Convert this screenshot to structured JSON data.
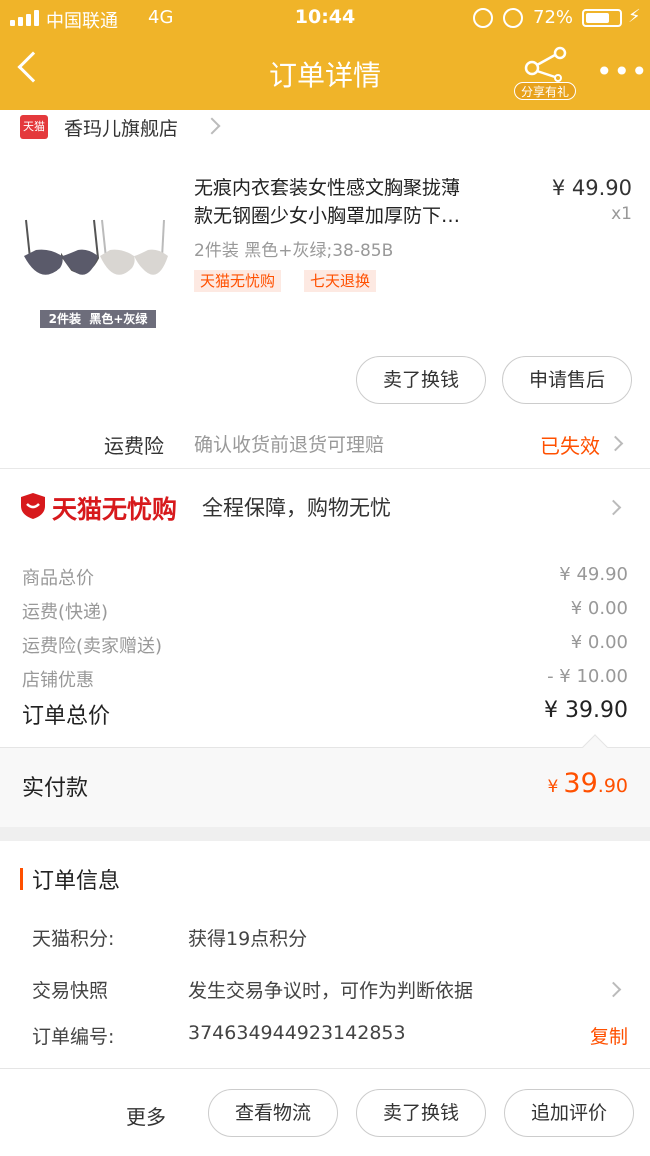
{
  "status_bar": {
    "carrier": "中国联通",
    "network": "4G",
    "time": "10:44",
    "battery": "72%",
    "battery_level": 0.72
  },
  "nav": {
    "title": "订单详情",
    "share_label": "分享有礼"
  },
  "shop": {
    "badge": "天猫",
    "name": "香玛儿旗舰店"
  },
  "product": {
    "title_line1": "无痕内衣套装女性感文胸聚拢薄",
    "title_line2": "款无钢圈少女小胸罩加厚防下…",
    "price": "¥ 49.90",
    "qty": "x1",
    "sku": "2件装 黑色+灰绿;38-85B",
    "image_caption": "2件装  黑色+灰绿",
    "tags": [
      "天猫无忧购",
      "七天退换"
    ]
  },
  "actions": {
    "sell": "卖了换钱",
    "after_sale": "申请售后"
  },
  "insurance": {
    "label": "运费险",
    "desc": "确认收货前退货可理赔",
    "status": "已失效"
  },
  "assure": {
    "brand": "天猫无忧购",
    "text": "全程保障，购物无忧"
  },
  "price_rows": [
    {
      "label": "商品总价",
      "value": "¥ 49.90"
    },
    {
      "label": "运费(快递)",
      "value": "¥ 0.00"
    },
    {
      "label": "运费险(卖家赠送)",
      "value": "¥ 0.00"
    },
    {
      "label": "店铺优惠",
      "value": "- ¥ 10.00"
    }
  ],
  "total": {
    "label": "订单总价",
    "value": "¥ 39.90"
  },
  "paid": {
    "label": "实付款",
    "currency": "¥",
    "int": "39",
    "dec": ".90"
  },
  "order_info": {
    "title": "订单信息",
    "rows": [
      {
        "label": "天猫积分:",
        "value": "获得19点积分"
      },
      {
        "label": "交易快照",
        "value": "发生交易争议时，可作为判断依据"
      },
      {
        "label": "订单编号:",
        "value": "374634944923142853",
        "action": "复制"
      }
    ]
  },
  "bottom": {
    "more": "更多",
    "logistics": "查看物流",
    "sell": "卖了换钱",
    "review": "追加评价"
  },
  "colors": {
    "header": "#f0b429",
    "accent": "#ff5000",
    "tmall_red": "#d7191c"
  }
}
